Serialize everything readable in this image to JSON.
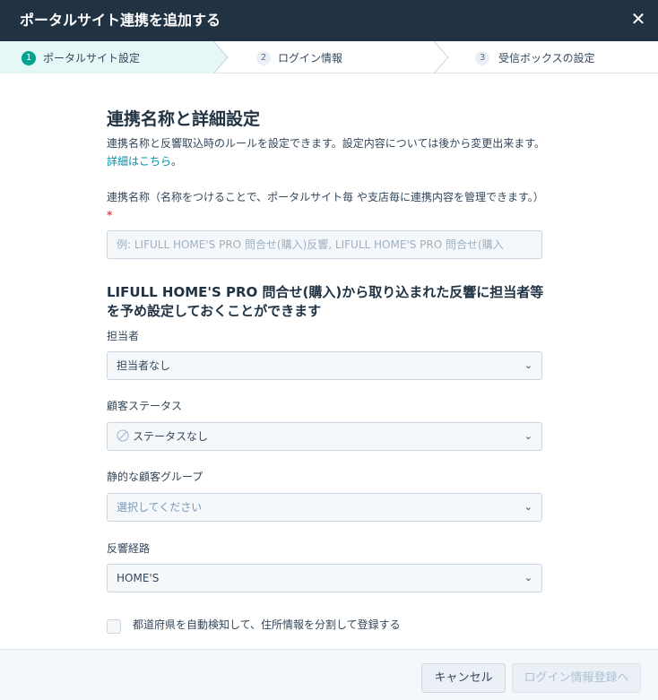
{
  "dialog": {
    "title": "ポータルサイト連携を追加する",
    "close_icon": "close-icon"
  },
  "steps": [
    {
      "number": "1",
      "label": "ポータルサイト設定",
      "active": true
    },
    {
      "number": "2",
      "label": "ログイン情報",
      "active": false
    },
    {
      "number": "3",
      "label": "受信ボックスの設定",
      "active": false
    }
  ],
  "section": {
    "title": "連携名称と詳細設定",
    "description": "連携名称と反響取込時のルールを設定できます。設定内容については後から変更出来ます。",
    "details_link": "詳細はこちら",
    "description_end": "。"
  },
  "connection_name": {
    "label": "連携名称（名称をつけることで、ポータルサイト毎 や支店毎に連携内容を管理できます。）",
    "required_mark": "*",
    "placeholder": "例: LIFULL HOME'S PRO 問合せ(購入)反響, LIFULL HOME'S PRO 問合せ(購入"
  },
  "defaults": {
    "heading": "LIFULL HOME'S PRO 問合せ(購入)から取り込まれた反響に担当者等を予め設定しておくことができます",
    "owner": {
      "label": "担当者",
      "value": "担当者なし"
    },
    "customer_status": {
      "label": "顧客ステータス",
      "value": "ステータスなし",
      "icon": "ban-icon"
    },
    "static_group": {
      "label": "静的な顧客グループ",
      "placeholder": "選択してください"
    },
    "response_route": {
      "label": "反響経路",
      "value": "HOME'S"
    }
  },
  "checkbox": {
    "label": "都道府県を自動検知して、住所情報を分割して登録する",
    "checked": false
  },
  "footer": {
    "cancel_label": "キャンセル",
    "next_label": "ログイン情報登録へ"
  },
  "colors": {
    "header_bg": "#213343",
    "active_step_bg": "#e5f8f6",
    "accent": "#00a38d",
    "link": "#0091ae"
  }
}
